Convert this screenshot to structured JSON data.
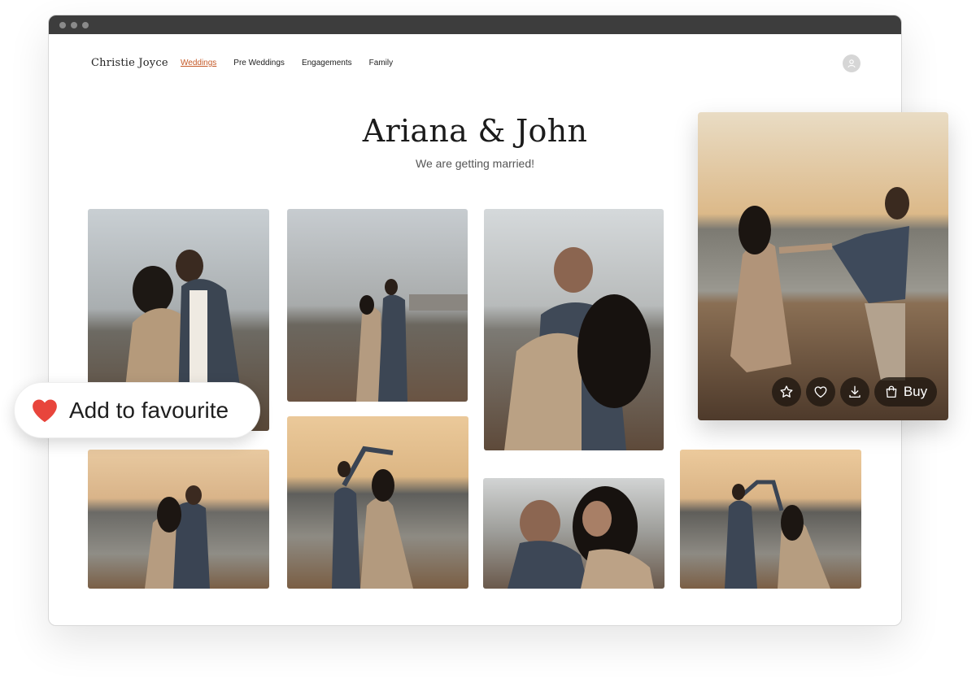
{
  "header": {
    "brand": "Christie Joyce",
    "nav": [
      {
        "label": "Weddings",
        "active": true
      },
      {
        "label": "Pre Weddings",
        "active": false
      },
      {
        "label": "Engagements",
        "active": false
      },
      {
        "label": "Family",
        "active": false
      }
    ],
    "avatar_icon": "user-icon"
  },
  "main": {
    "title": "Ariana & John",
    "subtitle": "We are getting married!"
  },
  "favourite_chip": {
    "label": "Add to favourite",
    "icon": "heart-icon",
    "icon_color": "#e8453c"
  },
  "preview": {
    "actions": [
      {
        "name": "star",
        "icon": "star-icon"
      },
      {
        "name": "heart",
        "icon": "heart-outline-icon"
      },
      {
        "name": "download",
        "icon": "download-icon"
      },
      {
        "name": "buy",
        "icon": "shopping-bag-icon",
        "label": "Buy"
      }
    ]
  },
  "colors": {
    "accent": "#c55a28",
    "titlebar": "#3d3d3d"
  }
}
